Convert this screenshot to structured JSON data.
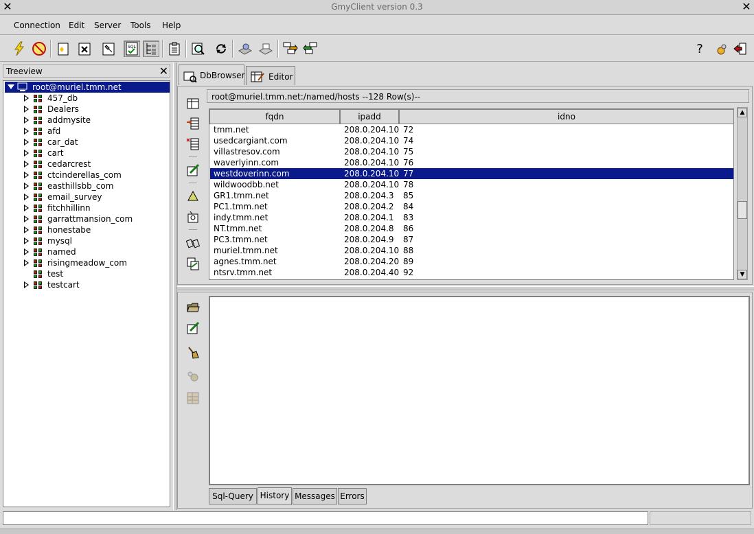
{
  "window": {
    "title": "GmyClient version 0.3",
    "close_glyph": "✕",
    "close_glyph2": "✕"
  },
  "menu": [
    "Connection",
    "Edit",
    "Server",
    "Tools",
    "Help"
  ],
  "toolbar": {
    "icons": [
      "connect-icon",
      "disconnect-icon",
      "new-icon",
      "close-doc-icon",
      "wrench-icon",
      "sql-toggle-icon",
      "tree-toggle-icon",
      "clipboard-icon",
      "find-icon",
      "refresh-icon",
      "print-preview-icon",
      "print-icon",
      "import-icon",
      "export-icon"
    ],
    "help_glyph": "?"
  },
  "treeview": {
    "title": "Treeview",
    "close_glyph": "✕",
    "root": "root@muriel.tmm.net",
    "items": [
      "457_db",
      "Dealers",
      "addmysite",
      "afd",
      "car_dat",
      "cart",
      "cedarcrest",
      "ctcinderellas_com",
      "easthillsbb_com",
      "email_survey",
      "fitchhillinn",
      "garrattmansion_com",
      "honestabe",
      "mysql",
      "named",
      "risingmeadow_com",
      "test",
      "testcart"
    ]
  },
  "tabs": [
    {
      "label": "DbBrowser",
      "active": true
    },
    {
      "label": "Editor",
      "active": false
    }
  ],
  "dbbrowser": {
    "path": "root@muriel.tmm.net:/named/hosts --128 Row(s)--",
    "columns": [
      "fqdn",
      "ipadd",
      "idno"
    ],
    "rows": [
      [
        "tmm.net",
        "208.0.204.10",
        "72"
      ],
      [
        "usedcargiant.com",
        "208.0.204.10",
        "74"
      ],
      [
        "villastresov.com",
        "208.0.204.10",
        "75"
      ],
      [
        "waverlyinn.com",
        "208.0.204.10",
        "76"
      ],
      [
        "westdoverinn.com",
        "208.0.204.10",
        "77"
      ],
      [
        "wildwoodbb.net",
        "208.0.204.10",
        "78"
      ],
      [
        "GR1.tmm.net",
        "208.0.204.3",
        "85"
      ],
      [
        "PC1.tmm.net",
        "208.0.204.2",
        "84"
      ],
      [
        "indy.tmm.net",
        "208.0.204.1",
        "83"
      ],
      [
        "NT.tmm.net",
        "208.0.204.8",
        "86"
      ],
      [
        "PC3.tmm.net",
        "208.0.204.9",
        "87"
      ],
      [
        "muriel.tmm.net",
        "208.0.204.10",
        "88"
      ],
      [
        "agnes.tmm.net",
        "208.0.204.20",
        "89"
      ],
      [
        "ntsrv.tmm.net",
        "208.0.204.40",
        "92"
      ]
    ],
    "selected_row": 4,
    "scroll_up": "▲",
    "scroll_down": "▼"
  },
  "bottom_tabs": [
    {
      "label": "Sql-Query",
      "active": false
    },
    {
      "label": "History",
      "active": true
    },
    {
      "label": "Messages",
      "active": false
    },
    {
      "label": "Errors",
      "active": false
    }
  ],
  "colors": {
    "selection": "#0a1a8c",
    "background": "#dcdcdc"
  }
}
